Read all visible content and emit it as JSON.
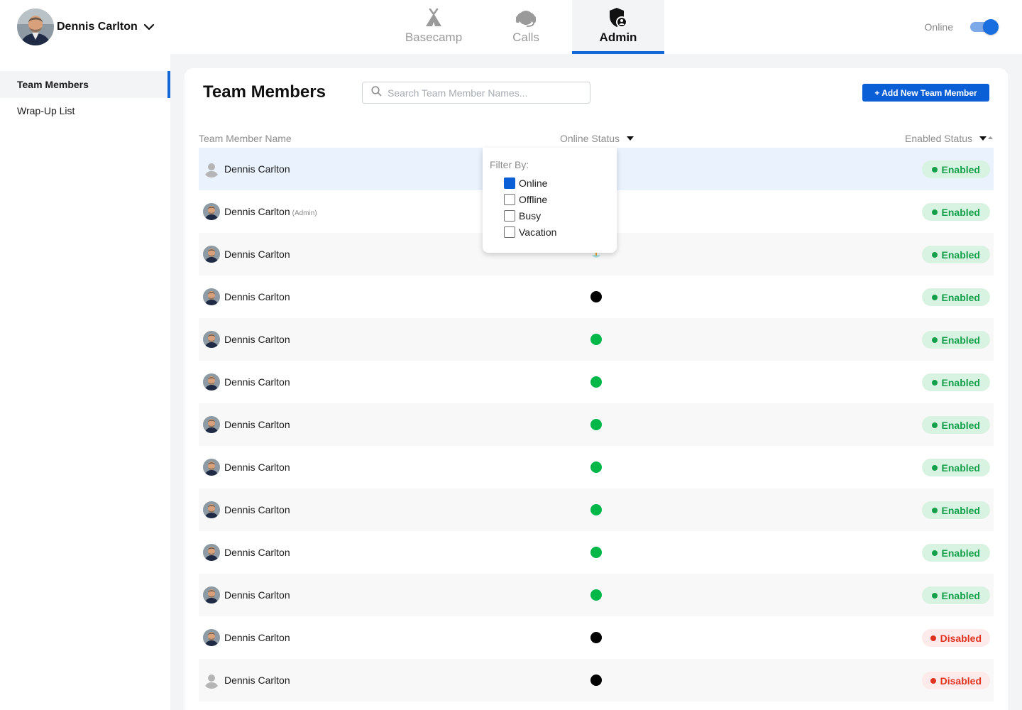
{
  "user": {
    "name": "Dennis Carlton"
  },
  "tabs": [
    {
      "label": "Basecamp",
      "icon": "basecamp-tent-icon"
    },
    {
      "label": "Calls",
      "icon": "headset-icon"
    },
    {
      "label": "Admin",
      "icon": "admin-shield-icon",
      "active": true
    }
  ],
  "status": {
    "label": "Online",
    "toggle_on": true
  },
  "sidebar": {
    "items": [
      {
        "label": "Team Members",
        "active": true
      },
      {
        "label": "Wrap-Up List"
      }
    ]
  },
  "main": {
    "title": "Team Members",
    "search_placeholder": "Search Team Member Names...",
    "add_button": "+ Add New Team Member",
    "columns": {
      "name": "Team Member Name",
      "online": "Online Status",
      "enabled": "Enabled Status"
    }
  },
  "filter": {
    "title": "Filter By:",
    "options": [
      {
        "label": "Online",
        "checked": true
      },
      {
        "label": "Offline",
        "checked": false
      },
      {
        "label": "Busy",
        "checked": false
      },
      {
        "label": "Vacation",
        "checked": false
      }
    ]
  },
  "colors": {
    "accent": "#1467d6",
    "online": "#00b84a",
    "offline": "#000000",
    "enabled_text": "#14a04a",
    "disabled_text": "#e0321e"
  },
  "members": [
    {
      "name": "Dennis Carlton",
      "tag": "",
      "avatar": "placeholder",
      "online": "hidden",
      "enabled": "Enabled"
    },
    {
      "name": "Dennis Carlton",
      "tag": "(Admin)",
      "avatar": "photo",
      "online": "hidden",
      "enabled": "Enabled"
    },
    {
      "name": "Dennis Carlton",
      "tag": "",
      "avatar": "photo",
      "online": "hidden",
      "enabled": "Enabled"
    },
    {
      "name": "Dennis Carlton",
      "tag": "",
      "avatar": "photo",
      "online": "offline",
      "enabled": "Enabled"
    },
    {
      "name": "Dennis Carlton",
      "tag": "",
      "avatar": "photo",
      "online": "online",
      "enabled": "Enabled"
    },
    {
      "name": "Dennis Carlton",
      "tag": "",
      "avatar": "photo",
      "online": "online",
      "enabled": "Enabled"
    },
    {
      "name": "Dennis Carlton",
      "tag": "",
      "avatar": "photo",
      "online": "online",
      "enabled": "Enabled"
    },
    {
      "name": "Dennis Carlton",
      "tag": "",
      "avatar": "photo",
      "online": "online",
      "enabled": "Enabled"
    },
    {
      "name": "Dennis Carlton",
      "tag": "",
      "avatar": "photo",
      "online": "online",
      "enabled": "Enabled"
    },
    {
      "name": "Dennis Carlton",
      "tag": "",
      "avatar": "photo",
      "online": "online",
      "enabled": "Enabled"
    },
    {
      "name": "Dennis Carlton",
      "tag": "",
      "avatar": "photo",
      "online": "online",
      "enabled": "Enabled"
    },
    {
      "name": "Dennis Carlton",
      "tag": "",
      "avatar": "photo",
      "online": "offline",
      "enabled": "Disabled"
    },
    {
      "name": "Dennis Carlton",
      "tag": "",
      "avatar": "placeholder",
      "online": "offline",
      "enabled": "Disabled"
    }
  ]
}
